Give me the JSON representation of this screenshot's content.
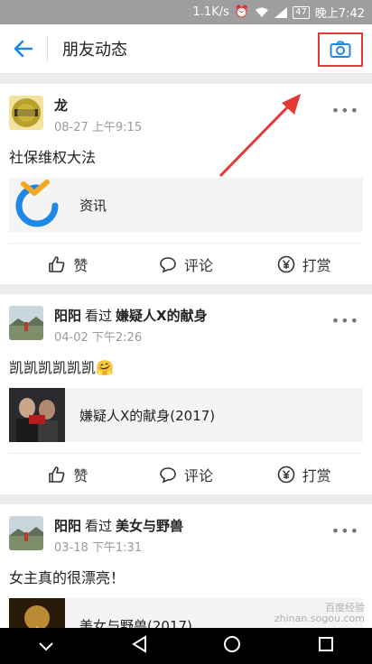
{
  "status": {
    "speed": "1.1K/s",
    "battery": "47",
    "time": "晚上7:42"
  },
  "appbar": {
    "title": "朋友动态"
  },
  "posts": [
    {
      "name": "龙",
      "action": "",
      "object": "",
      "time": "08-27 上午9:15",
      "text": "社保维权大法",
      "share_title": "资讯"
    },
    {
      "name": "阳阳",
      "action": "看过",
      "object": "嫌疑人X的献身",
      "time": "04-02 下午2:26",
      "text": "凯凯凯凯凯凯🤗",
      "share_title": "嫌疑人X的献身(2017)"
    },
    {
      "name": "阳阳",
      "action": "看过",
      "object": "美女与野兽",
      "time": "03-18 下午1:31",
      "text": "女主真的很漂亮！",
      "share_title": "美女与野兽(2017)"
    }
  ],
  "actions": {
    "like": "赞",
    "comment": "评论",
    "reward": "打赏"
  },
  "watermark": {
    "line1": "百度经验",
    "line2": "zhinan.sogou.com"
  }
}
